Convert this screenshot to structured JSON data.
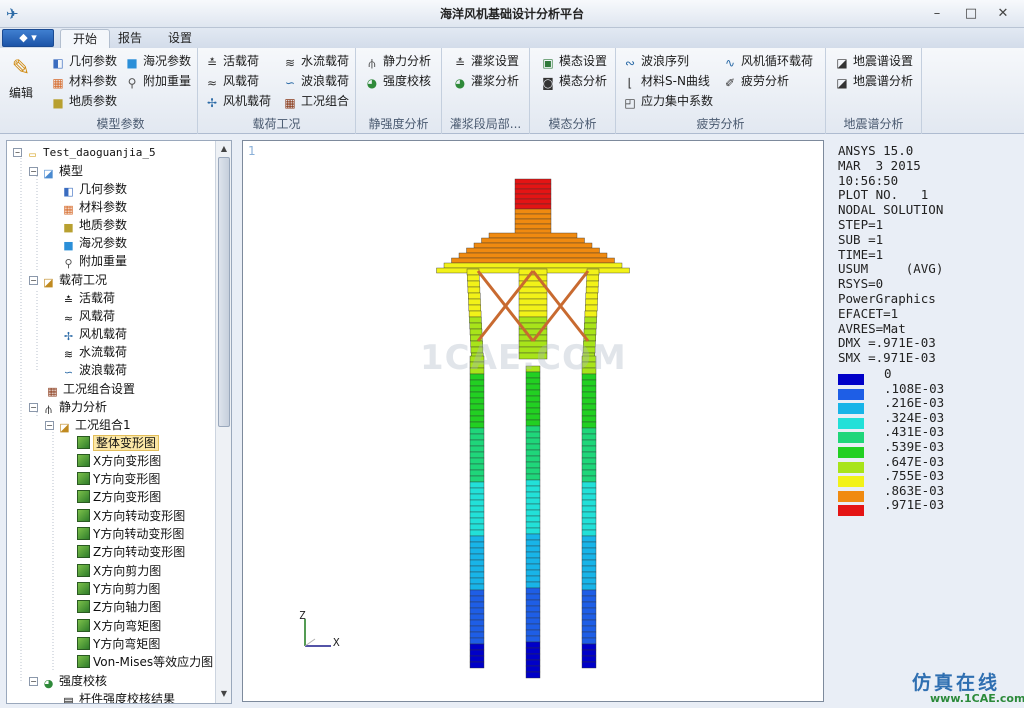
{
  "window": {
    "title": "海洋风机基础设计分析平台",
    "minimize": "–",
    "maximize": "□",
    "close": "✕"
  },
  "app_menu": {
    "label": "◆ ▾"
  },
  "tabs": [
    {
      "label": "开始"
    },
    {
      "label": "报告"
    },
    {
      "label": "设置"
    }
  ],
  "ribbon": {
    "edit_label": "编辑",
    "groups": [
      {
        "label": "模型参数",
        "buttons": [
          {
            "label": "几何参数"
          },
          {
            "label": "海况参数"
          },
          {
            "label": "材料参数"
          },
          {
            "label": "附加重量"
          },
          {
            "label": "地质参数"
          }
        ]
      },
      {
        "label": "载荷工况",
        "buttons": [
          {
            "label": "活载荷"
          },
          {
            "label": "水流载荷"
          },
          {
            "label": "风载荷"
          },
          {
            "label": "波浪载荷"
          },
          {
            "label": "风机载荷"
          },
          {
            "label": "工况组合"
          }
        ]
      },
      {
        "label": "静强度分析",
        "buttons": [
          {
            "label": "静力分析"
          },
          {
            "label": "强度校核"
          }
        ]
      },
      {
        "label": "灌浆段局部...",
        "buttons": [
          {
            "label": "灌浆设置"
          },
          {
            "label": "灌浆分析"
          }
        ]
      },
      {
        "label": "模态分析",
        "buttons": [
          {
            "label": "模态设置"
          },
          {
            "label": "模态分析"
          }
        ]
      },
      {
        "label": "疲劳分析",
        "buttons": [
          {
            "label": "波浪序列"
          },
          {
            "label": "风机循环载荷"
          },
          {
            "label": "材料S-N曲线"
          },
          {
            "label": "疲劳分析"
          },
          {
            "label": "应力集中系数"
          }
        ]
      },
      {
        "label": "地震谱分析",
        "buttons": [
          {
            "label": "地震谱设置"
          },
          {
            "label": "地震谱分析"
          }
        ]
      }
    ]
  },
  "tree": {
    "root": "Test_daoguanjia_5",
    "items": [
      {
        "label": "模型"
      },
      {
        "label": "几何参数"
      },
      {
        "label": "材料参数"
      },
      {
        "label": "地质参数"
      },
      {
        "label": "海况参数"
      },
      {
        "label": "附加重量"
      },
      {
        "label": "载荷工况"
      },
      {
        "label": "活载荷"
      },
      {
        "label": "风载荷"
      },
      {
        "label": "风机载荷"
      },
      {
        "label": "水流载荷"
      },
      {
        "label": "波浪载荷"
      },
      {
        "label": "工况组合设置"
      },
      {
        "label": "静力分析"
      },
      {
        "label": "工况组合1"
      },
      {
        "label": "整体变形图"
      },
      {
        "label": "X方向变形图"
      },
      {
        "label": "Y方向变形图"
      },
      {
        "label": "Z方向变形图"
      },
      {
        "label": "X方向转动变形图"
      },
      {
        "label": "Y方向转动变形图"
      },
      {
        "label": "Z方向转动变形图"
      },
      {
        "label": "X方向剪力图"
      },
      {
        "label": "Y方向剪力图"
      },
      {
        "label": "Z方向轴力图"
      },
      {
        "label": "X方向弯矩图"
      },
      {
        "label": "Y方向弯矩图"
      },
      {
        "label": "Von-Mises等效应力图"
      },
      {
        "label": "强度校核"
      },
      {
        "label": "杆件强度校核结果"
      }
    ]
  },
  "viewport": {
    "window_number": "1",
    "watermark": "1CAE.COM",
    "axis_labels": {
      "z": "Z",
      "x": "X"
    },
    "legend_lines": [
      "ANSYS 15.0",
      "MAR  3 2015",
      "10:56:50",
      "PLOT NO.   1",
      "NODAL SOLUTION",
      "STEP=1",
      "SUB =1",
      "TIME=1",
      "USUM     (AVG)",
      "RSYS=0",
      "PowerGraphics",
      "EFACET=1",
      "AVRES=Mat",
      "DMX =.971E-03",
      "SMX =.971E-03"
    ],
    "contour": [
      {
        "value": "0",
        "color": "#0000c8"
      },
      {
        "value": ".108E-03",
        "color": "#1e5ee6"
      },
      {
        "value": ".216E-03",
        "color": "#18b4e8"
      },
      {
        "value": ".324E-03",
        "color": "#22e0d8"
      },
      {
        "value": ".431E-03",
        "color": "#1fd67a"
      },
      {
        "value": ".539E-03",
        "color": "#22d022"
      },
      {
        "value": ".647E-03",
        "color": "#a8e41a"
      },
      {
        "value": ".755E-03",
        "color": "#f2f218"
      },
      {
        "value": ".863E-03",
        "color": "#f08a10"
      },
      {
        "value": ".971E-03",
        "color": "#e41414"
      }
    ]
  },
  "branding": {
    "name": "仿真在线",
    "url": "www.1CAE.com"
  }
}
